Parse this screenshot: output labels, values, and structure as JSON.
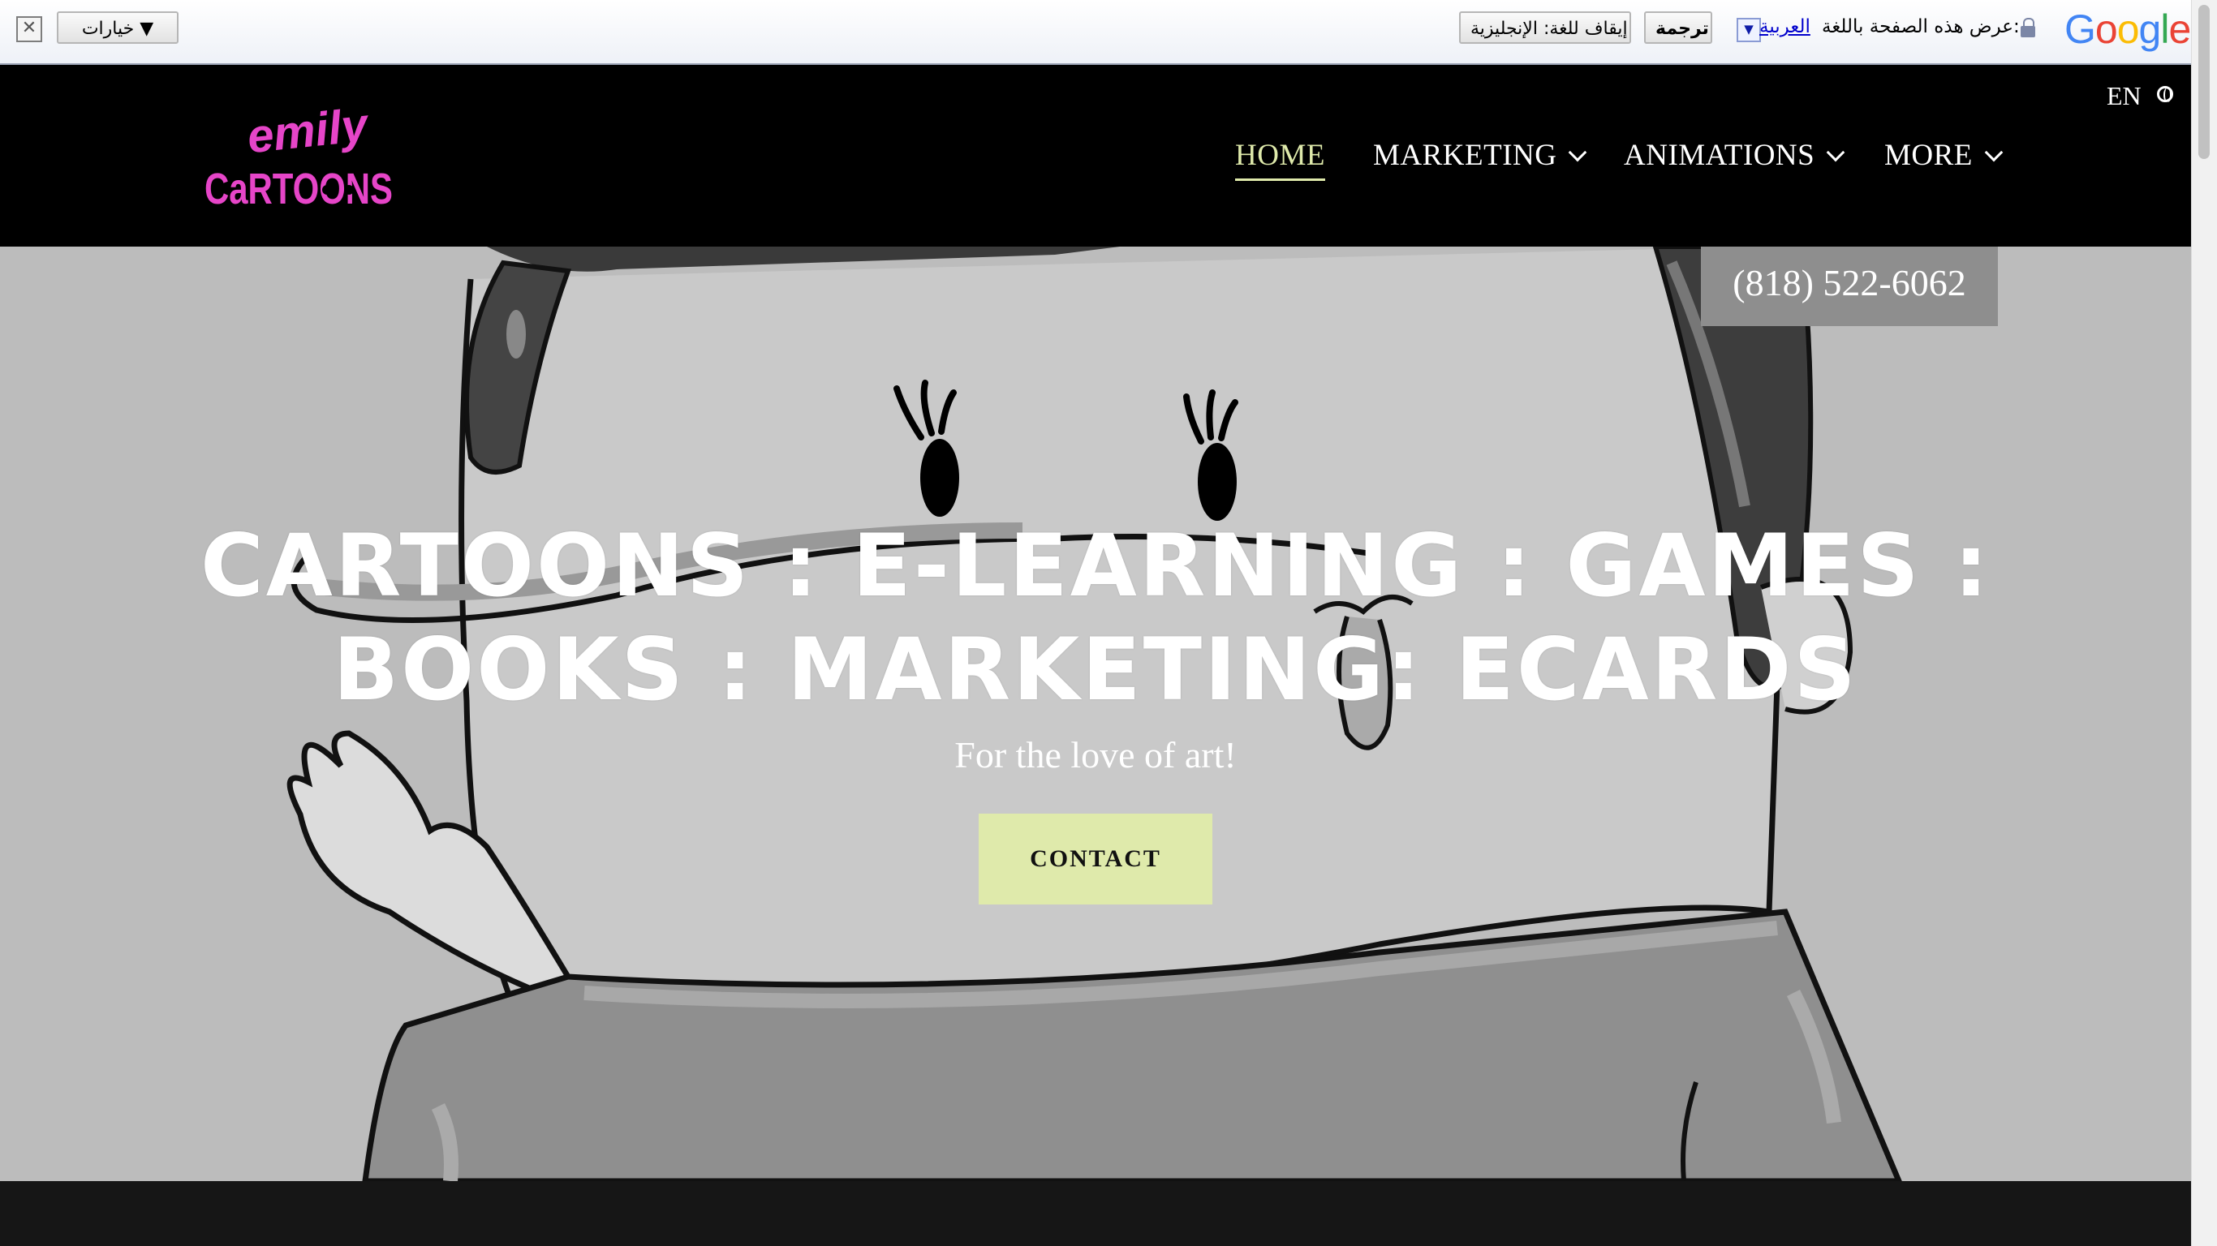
{
  "translate_bar": {
    "options_label": "خيارات ▼",
    "stop_label": "إيقاف للغة: الإنجليزية",
    "translate_label": "ترجمة",
    "language_link": "العربية",
    "prompt": "عرض هذه الصفحة باللغة:",
    "brand": "Google",
    "icons": [
      "close-icon",
      "dropdown-arrow-icon",
      "lock-icon"
    ]
  },
  "header": {
    "logo_text": [
      "emily",
      "CaRTOONS"
    ],
    "language": "EN",
    "nav": [
      {
        "label": "HOME",
        "active": true
      },
      {
        "label": "MARKETING",
        "dropdown": true
      },
      {
        "label": "ANIMATIONS",
        "dropdown": true
      },
      {
        "label": "MORE",
        "dropdown": true
      }
    ]
  },
  "hero": {
    "phone": "(818) 522-6062",
    "headline_line1": "CARTOONS : E-LEARNING : GAMES :",
    "headline_line2": "BOOKS : MARKETING: ECARDS",
    "tagline": "For the love of art!",
    "cta_label": "CONTACT"
  },
  "colors": {
    "accent": "#dfeaab",
    "logo_pink": "#e645c8",
    "header_bg": "#000000",
    "hero_bg": "#bcbcbc"
  }
}
